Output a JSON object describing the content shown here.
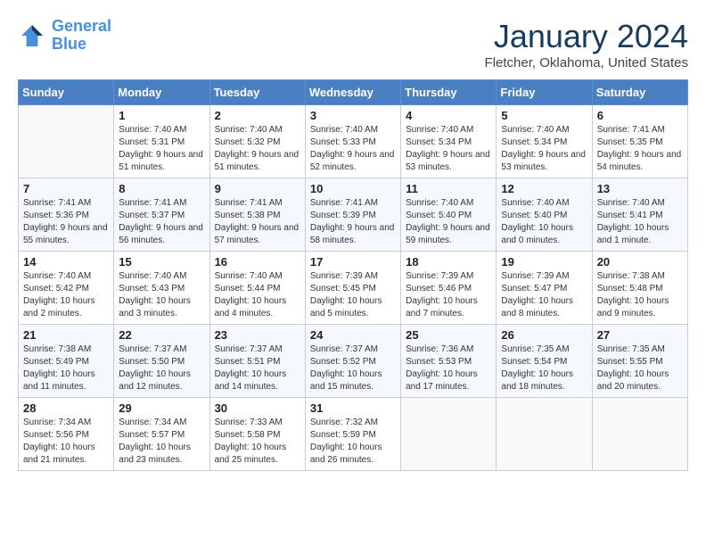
{
  "header": {
    "logo_line1": "General",
    "logo_line2": "Blue",
    "month": "January 2024",
    "location": "Fletcher, Oklahoma, United States"
  },
  "weekdays": [
    "Sunday",
    "Monday",
    "Tuesday",
    "Wednesday",
    "Thursday",
    "Friday",
    "Saturday"
  ],
  "weeks": [
    [
      {
        "day": "",
        "sunrise": "",
        "sunset": "",
        "daylight": ""
      },
      {
        "day": "1",
        "sunrise": "Sunrise: 7:40 AM",
        "sunset": "Sunset: 5:31 PM",
        "daylight": "Daylight: 9 hours and 51 minutes."
      },
      {
        "day": "2",
        "sunrise": "Sunrise: 7:40 AM",
        "sunset": "Sunset: 5:32 PM",
        "daylight": "Daylight: 9 hours and 51 minutes."
      },
      {
        "day": "3",
        "sunrise": "Sunrise: 7:40 AM",
        "sunset": "Sunset: 5:33 PM",
        "daylight": "Daylight: 9 hours and 52 minutes."
      },
      {
        "day": "4",
        "sunrise": "Sunrise: 7:40 AM",
        "sunset": "Sunset: 5:34 PM",
        "daylight": "Daylight: 9 hours and 53 minutes."
      },
      {
        "day": "5",
        "sunrise": "Sunrise: 7:40 AM",
        "sunset": "Sunset: 5:34 PM",
        "daylight": "Daylight: 9 hours and 53 minutes."
      },
      {
        "day": "6",
        "sunrise": "Sunrise: 7:41 AM",
        "sunset": "Sunset: 5:35 PM",
        "daylight": "Daylight: 9 hours and 54 minutes."
      }
    ],
    [
      {
        "day": "7",
        "sunrise": "Sunrise: 7:41 AM",
        "sunset": "Sunset: 5:36 PM",
        "daylight": "Daylight: 9 hours and 55 minutes."
      },
      {
        "day": "8",
        "sunrise": "Sunrise: 7:41 AM",
        "sunset": "Sunset: 5:37 PM",
        "daylight": "Daylight: 9 hours and 56 minutes."
      },
      {
        "day": "9",
        "sunrise": "Sunrise: 7:41 AM",
        "sunset": "Sunset: 5:38 PM",
        "daylight": "Daylight: 9 hours and 57 minutes."
      },
      {
        "day": "10",
        "sunrise": "Sunrise: 7:41 AM",
        "sunset": "Sunset: 5:39 PM",
        "daylight": "Daylight: 9 hours and 58 minutes."
      },
      {
        "day": "11",
        "sunrise": "Sunrise: 7:40 AM",
        "sunset": "Sunset: 5:40 PM",
        "daylight": "Daylight: 9 hours and 59 minutes."
      },
      {
        "day": "12",
        "sunrise": "Sunrise: 7:40 AM",
        "sunset": "Sunset: 5:40 PM",
        "daylight": "Daylight: 10 hours and 0 minutes."
      },
      {
        "day": "13",
        "sunrise": "Sunrise: 7:40 AM",
        "sunset": "Sunset: 5:41 PM",
        "daylight": "Daylight: 10 hours and 1 minute."
      }
    ],
    [
      {
        "day": "14",
        "sunrise": "Sunrise: 7:40 AM",
        "sunset": "Sunset: 5:42 PM",
        "daylight": "Daylight: 10 hours and 2 minutes."
      },
      {
        "day": "15",
        "sunrise": "Sunrise: 7:40 AM",
        "sunset": "Sunset: 5:43 PM",
        "daylight": "Daylight: 10 hours and 3 minutes."
      },
      {
        "day": "16",
        "sunrise": "Sunrise: 7:40 AM",
        "sunset": "Sunset: 5:44 PM",
        "daylight": "Daylight: 10 hours and 4 minutes."
      },
      {
        "day": "17",
        "sunrise": "Sunrise: 7:39 AM",
        "sunset": "Sunset: 5:45 PM",
        "daylight": "Daylight: 10 hours and 5 minutes."
      },
      {
        "day": "18",
        "sunrise": "Sunrise: 7:39 AM",
        "sunset": "Sunset: 5:46 PM",
        "daylight": "Daylight: 10 hours and 7 minutes."
      },
      {
        "day": "19",
        "sunrise": "Sunrise: 7:39 AM",
        "sunset": "Sunset: 5:47 PM",
        "daylight": "Daylight: 10 hours and 8 minutes."
      },
      {
        "day": "20",
        "sunrise": "Sunrise: 7:38 AM",
        "sunset": "Sunset: 5:48 PM",
        "daylight": "Daylight: 10 hours and 9 minutes."
      }
    ],
    [
      {
        "day": "21",
        "sunrise": "Sunrise: 7:38 AM",
        "sunset": "Sunset: 5:49 PM",
        "daylight": "Daylight: 10 hours and 11 minutes."
      },
      {
        "day": "22",
        "sunrise": "Sunrise: 7:37 AM",
        "sunset": "Sunset: 5:50 PM",
        "daylight": "Daylight: 10 hours and 12 minutes."
      },
      {
        "day": "23",
        "sunrise": "Sunrise: 7:37 AM",
        "sunset": "Sunset: 5:51 PM",
        "daylight": "Daylight: 10 hours and 14 minutes."
      },
      {
        "day": "24",
        "sunrise": "Sunrise: 7:37 AM",
        "sunset": "Sunset: 5:52 PM",
        "daylight": "Daylight: 10 hours and 15 minutes."
      },
      {
        "day": "25",
        "sunrise": "Sunrise: 7:36 AM",
        "sunset": "Sunset: 5:53 PM",
        "daylight": "Daylight: 10 hours and 17 minutes."
      },
      {
        "day": "26",
        "sunrise": "Sunrise: 7:35 AM",
        "sunset": "Sunset: 5:54 PM",
        "daylight": "Daylight: 10 hours and 18 minutes."
      },
      {
        "day": "27",
        "sunrise": "Sunrise: 7:35 AM",
        "sunset": "Sunset: 5:55 PM",
        "daylight": "Daylight: 10 hours and 20 minutes."
      }
    ],
    [
      {
        "day": "28",
        "sunrise": "Sunrise: 7:34 AM",
        "sunset": "Sunset: 5:56 PM",
        "daylight": "Daylight: 10 hours and 21 minutes."
      },
      {
        "day": "29",
        "sunrise": "Sunrise: 7:34 AM",
        "sunset": "Sunset: 5:57 PM",
        "daylight": "Daylight: 10 hours and 23 minutes."
      },
      {
        "day": "30",
        "sunrise": "Sunrise: 7:33 AM",
        "sunset": "Sunset: 5:58 PM",
        "daylight": "Daylight: 10 hours and 25 minutes."
      },
      {
        "day": "31",
        "sunrise": "Sunrise: 7:32 AM",
        "sunset": "Sunset: 5:59 PM",
        "daylight": "Daylight: 10 hours and 26 minutes."
      },
      {
        "day": "",
        "sunrise": "",
        "sunset": "",
        "daylight": ""
      },
      {
        "day": "",
        "sunrise": "",
        "sunset": "",
        "daylight": ""
      },
      {
        "day": "",
        "sunrise": "",
        "sunset": "",
        "daylight": ""
      }
    ]
  ]
}
